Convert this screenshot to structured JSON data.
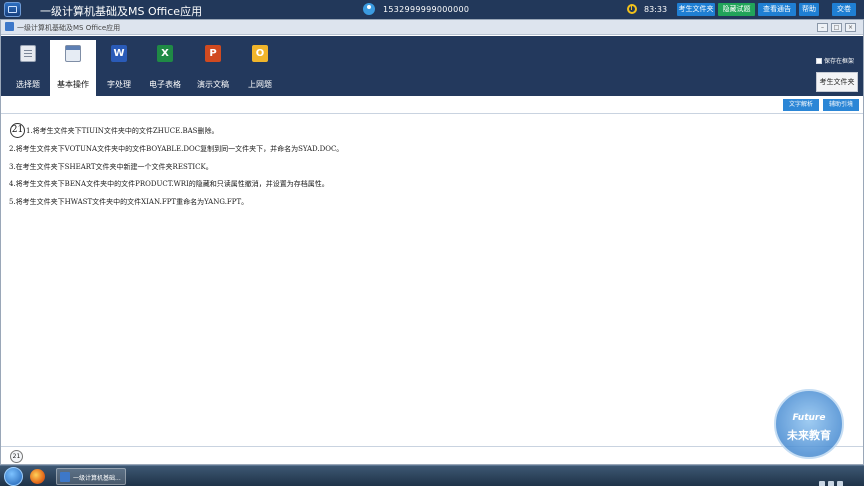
{
  "topbar": {
    "title": "一级计算机基础及MS Office应用",
    "user_id": "1532999999000000",
    "time": "83:33",
    "buttons": [
      {
        "label": "考生文件夹",
        "color": "#1f7fd3"
      },
      {
        "label": "隐藏试题",
        "color": "#21a45a"
      },
      {
        "label": "查看通告",
        "color": "#1f7fd3"
      },
      {
        "label": "帮助",
        "color": "#1f7fd3"
      },
      {
        "label": "交卷",
        "color": "#1f7fd3"
      }
    ]
  },
  "window": {
    "title": "一级计算机基础及MS Office应用",
    "controls": [
      "–",
      "□",
      "×"
    ]
  },
  "ribbon": {
    "tabs": [
      {
        "label": "选择题",
        "icon": "document-icon"
      },
      {
        "label": "基本操作",
        "icon": "window-icon",
        "active": true
      },
      {
        "label": "字处理",
        "icon": "word-icon",
        "letter": "W"
      },
      {
        "label": "电子表格",
        "icon": "excel-icon",
        "letter": "X"
      },
      {
        "label": "演示文稿",
        "icon": "powerpoint-icon",
        "letter": "P"
      },
      {
        "label": "上网题",
        "icon": "outlook-icon",
        "letter": "O"
      }
    ],
    "save_checkbox_label": "保存在框架",
    "folder_button": "考生文件夹"
  },
  "subbar": {
    "buttons": [
      "文字解析",
      "辅助引境"
    ]
  },
  "content": {
    "question_number": "21",
    "tasks": [
      "1.将考生文件夹下TIUIN文件夹中的文件ZHUCE.BAS删除。",
      "2.将考生文件夹下VOTUNA文件夹中的文件BOYABLE.DOC复制到同一文件夹下，并命名为SYAD.DOC。",
      "3.在考生文件夹下SHEART文件夹中新建一个文件夹RESTICK。",
      "4.将考生文件夹下BENA文件夹中的文件PRODUCT.WRI的隐藏和只读属性撤消，并设置为存档属性。",
      "5.将考生文件夹下HWAST文件夹中的文件XIAN.FPT重命名为YANG.FPT。"
    ]
  },
  "bottombar": {
    "page_number": "21"
  },
  "watermark": {
    "en": "Future",
    "cn": "未来教育"
  },
  "taskbar": {
    "task_label": "一级计算机基础..."
  }
}
